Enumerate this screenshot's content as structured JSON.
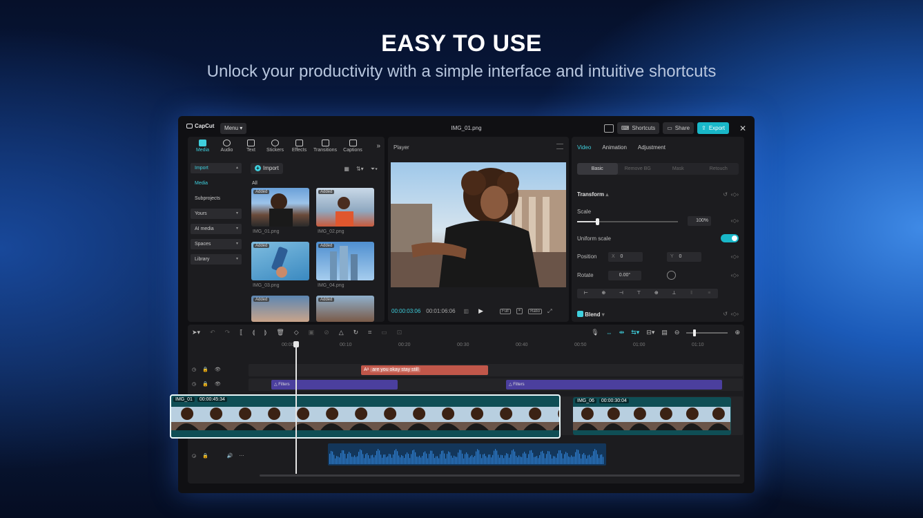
{
  "hero": {
    "title": "EASY TO USE",
    "subtitle": "Unlock your productivity with a simple interface and intuitive shortcuts"
  },
  "app": {
    "logo": "CapCut",
    "menu_label": "Menu",
    "file_title": "IMG_01.png",
    "shortcuts_label": "Shortcuts",
    "share_label": "Share",
    "export_label": "Export",
    "accent": "#19b7c8"
  },
  "media": {
    "tabs": [
      {
        "label": "Media",
        "icon": "media-icon"
      },
      {
        "label": "Audio",
        "icon": "audio-icon"
      },
      {
        "label": "Text",
        "icon": "text-icon"
      },
      {
        "label": "Stickers",
        "icon": "stickers-icon"
      },
      {
        "label": "Effects",
        "icon": "effects-icon"
      },
      {
        "label": "Transitions",
        "icon": "transitions-icon"
      },
      {
        "label": "Captions",
        "icon": "captions-icon"
      }
    ],
    "sidebar": [
      "Import",
      "Media",
      "Subprojects",
      "Yours",
      "AI media",
      "Spaces",
      "Library"
    ],
    "import_label": "Import",
    "all_label": "All",
    "thumbs": [
      {
        "name": "IMG_01.png",
        "badge": "Added"
      },
      {
        "name": "IMG_02.png",
        "badge": "Added"
      },
      {
        "name": "IMG_03.png",
        "badge": "Added"
      },
      {
        "name": "IMG_04.png",
        "badge": "Added"
      },
      {
        "name": "",
        "badge": "Added"
      },
      {
        "name": "",
        "badge": "Added"
      }
    ]
  },
  "player": {
    "label": "Player",
    "current_time": "00:00:03:06",
    "total_time": "00:01:06:06",
    "full_label": "Full",
    "ratio_label": "Ratio"
  },
  "props": {
    "tabs": [
      "Video",
      "Animation",
      "Adjustment"
    ],
    "subtabs": [
      "Basic",
      "Remove BG",
      "Mask",
      "Retouch"
    ],
    "transform_label": "Transform",
    "scale_label": "Scale",
    "scale_value": "100%",
    "uniform_scale_label": "Uniform scale",
    "uniform_scale_on": true,
    "position_label": "Position",
    "pos_x_label": "X",
    "pos_x": "0",
    "pos_y_label": "Y",
    "pos_y": "0",
    "rotate_label": "Rotate",
    "rotate_value": "0.00°",
    "blend_label": "Blend"
  },
  "timeline": {
    "ruler": [
      "00:00",
      "00:10",
      "00:20",
      "00:30",
      "00:40",
      "00:50",
      "01:00",
      "01:10"
    ],
    "text_clip": "are you okay stay still",
    "filter_label": "Filters",
    "main_clip_name": "IMG_01",
    "main_clip_duration": "00:00:45:34",
    "clip2_name": "IMG_06",
    "clip2_duration": "00:00:30:04"
  }
}
